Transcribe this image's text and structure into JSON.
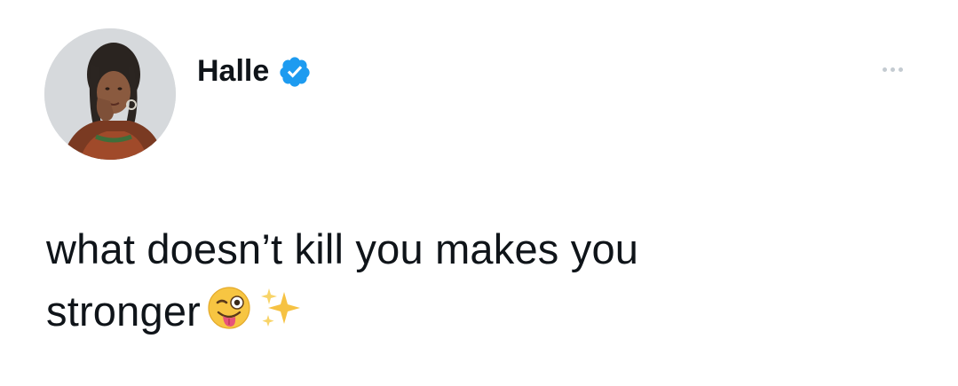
{
  "tweet": {
    "author": {
      "display_name": "Halle",
      "verified": true,
      "handle": ""
    },
    "text_line1": "what doesn’t kill you makes you",
    "text_line2": "stronger",
    "emojis": [
      "winking-face-with-tongue-icon",
      "sparkles-icon"
    ],
    "more_menu_icon": "more-options-icon"
  },
  "colors": {
    "verified_blue": "#1d9bf0",
    "text": "#0f1419",
    "muted": "#c4cbd1",
    "background": "#ffffff"
  }
}
